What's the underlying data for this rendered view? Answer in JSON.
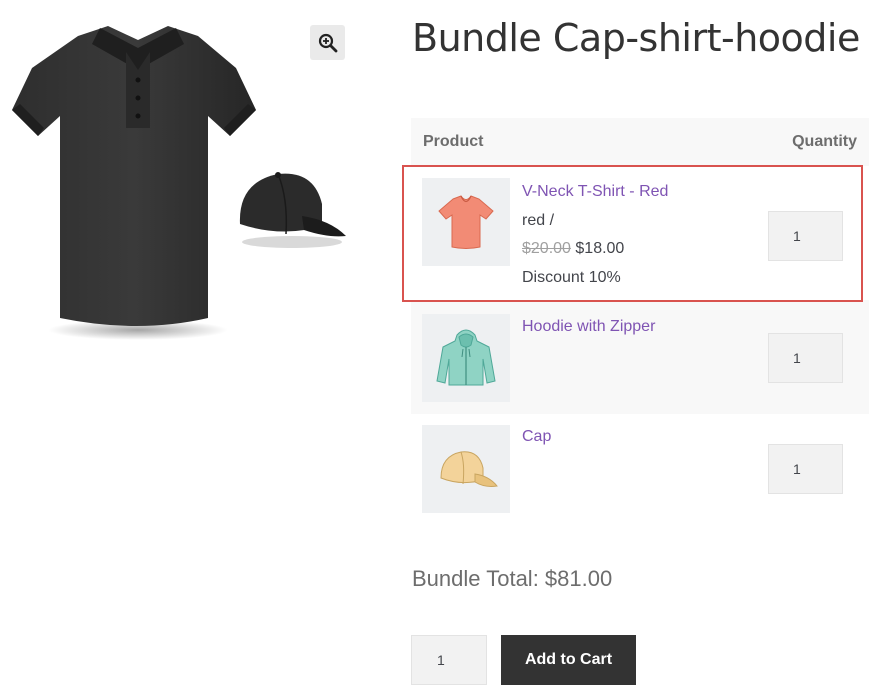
{
  "product": {
    "title": "Bundle Cap-shirt-hoodie"
  },
  "gallery": {
    "zoom_icon": "magnifier-plus-icon",
    "main_image": "black polo shirt with cap"
  },
  "bundle_table": {
    "header_product": "Product",
    "header_quantity": "Quantity",
    "items": [
      {
        "name": "V-Neck T-Shirt - Red",
        "variation": "red /",
        "price_old": "$20.00",
        "price_new": "$18.00",
        "discount": "Discount 10%",
        "quantity": "1",
        "thumb_color": "#f28b75"
      },
      {
        "name": "Hoodie with Zipper",
        "quantity": "1",
        "thumb_color": "#8fd3c4"
      },
      {
        "name": "Cap",
        "quantity": "1",
        "thumb_color": "#f3d39a"
      }
    ]
  },
  "total": {
    "text": "Bundle Total: $81.00"
  },
  "cart": {
    "quantity": "1",
    "button_label": "Add to Cart"
  },
  "colors": {
    "link": "#7f54b3",
    "highlight": "#d9534f",
    "button_bg": "#333333"
  }
}
